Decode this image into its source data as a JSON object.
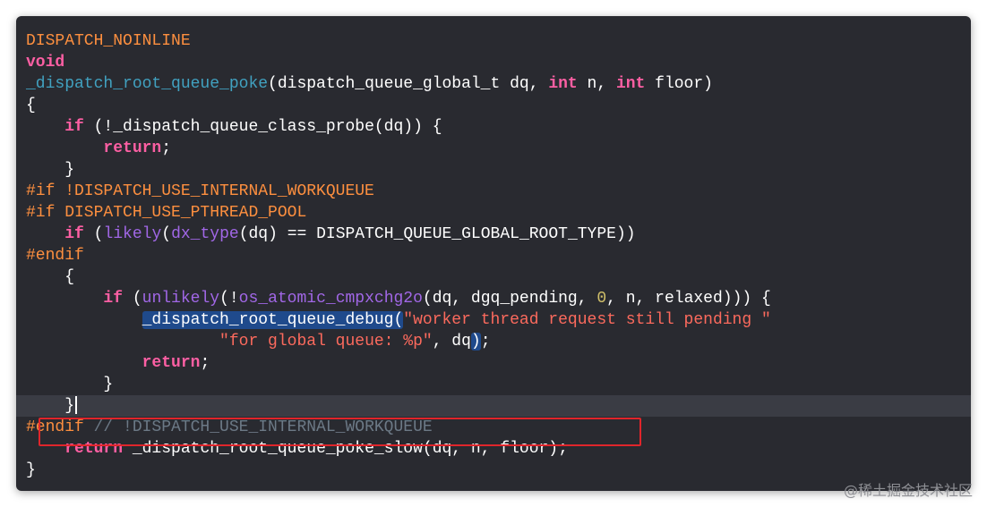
{
  "editor": {
    "background": "#292a30",
    "lines": [
      [
        {
          "t": "DISPATCH_NOINLINE",
          "c": "macro"
        }
      ],
      [
        {
          "t": "void",
          "c": "kw"
        }
      ],
      [
        {
          "t": "_dispatch_root_queue_poke",
          "c": "fn-def"
        },
        {
          "t": "(dispatch_queue_global_t dq, ",
          "c": "plain"
        },
        {
          "t": "int",
          "c": "kw"
        },
        {
          "t": " n, ",
          "c": "plain"
        },
        {
          "t": "int",
          "c": "kw"
        },
        {
          "t": " floor)",
          "c": "plain"
        }
      ],
      [
        {
          "t": "{",
          "c": "plain"
        }
      ],
      [
        {
          "t": "    ",
          "c": "plain"
        },
        {
          "t": "if",
          "c": "kw"
        },
        {
          "t": " (!_dispatch_queue_class_probe(dq)) {",
          "c": "plain"
        }
      ],
      [
        {
          "t": "        ",
          "c": "plain"
        },
        {
          "t": "return",
          "c": "kw"
        },
        {
          "t": ";",
          "c": "plain"
        }
      ],
      [
        {
          "t": "    }",
          "c": "plain"
        }
      ],
      [
        {
          "t": "#if !DISPATCH_USE_INTERNAL_WORKQUEUE",
          "c": "macro"
        }
      ],
      [
        {
          "t": "#if DISPATCH_USE_PTHREAD_POOL",
          "c": "macro"
        }
      ],
      [
        {
          "t": "    ",
          "c": "plain"
        },
        {
          "t": "if",
          "c": "kw"
        },
        {
          "t": " (",
          "c": "plain"
        },
        {
          "t": "likely",
          "c": "fn"
        },
        {
          "t": "(",
          "c": "plain"
        },
        {
          "t": "dx_type",
          "c": "fn"
        },
        {
          "t": "(dq) == DISPATCH_QUEUE_GLOBAL_ROOT_TYPE))",
          "c": "plain"
        }
      ],
      [
        {
          "t": "#endif",
          "c": "macro"
        }
      ],
      [
        {
          "t": "    {",
          "c": "plain"
        }
      ],
      [
        {
          "t": "        ",
          "c": "plain"
        },
        {
          "t": "if",
          "c": "kw"
        },
        {
          "t": " (",
          "c": "plain"
        },
        {
          "t": "unlikely",
          "c": "fn"
        },
        {
          "t": "(!",
          "c": "plain"
        },
        {
          "t": "os_atomic_cmpxchg2o",
          "c": "fn"
        },
        {
          "t": "(dq, dgq_pending, ",
          "c": "plain"
        },
        {
          "t": "0",
          "c": "num"
        },
        {
          "t": ", n, relaxed))) {",
          "c": "plain"
        }
      ],
      [
        {
          "t": "            ",
          "c": "plain"
        },
        {
          "t": "_dispatch_root_queue_debug(",
          "c": "plain",
          "hl": true
        },
        {
          "t": "\"worker thread request still pending \"",
          "c": "str"
        }
      ],
      [
        {
          "t": "                    ",
          "c": "plain"
        },
        {
          "t": "\"for global queue: %p\"",
          "c": "str"
        },
        {
          "t": ", dq",
          "c": "plain"
        },
        {
          "t": ")",
          "c": "plain",
          "hl": true
        },
        {
          "t": ";",
          "c": "plain"
        }
      ],
      [
        {
          "t": "            ",
          "c": "plain"
        },
        {
          "t": "return",
          "c": "kw"
        },
        {
          "t": ";",
          "c": "plain"
        }
      ],
      [
        {
          "t": "        }",
          "c": "plain"
        }
      ],
      [
        {
          "t": "    }",
          "c": "plain",
          "caret": true
        }
      ],
      [
        {
          "t": "#endif",
          "c": "macro"
        },
        {
          "t": " // !DISPATCH_USE_INTERNAL_WORKQUEUE",
          "c": "cmt"
        }
      ],
      [
        {
          "t": "    ",
          "c": "plain"
        },
        {
          "t": "return",
          "c": "kw"
        },
        {
          "t": " _dispatch_root_queue_poke_slow(dq, n, floor);",
          "c": "plain"
        }
      ],
      [
        {
          "t": "}",
          "c": "plain"
        }
      ]
    ],
    "current_line_index": 17,
    "highlighted_box_line_index": 19
  },
  "watermark": "@稀土掘金技术社区",
  "colors": {
    "keyword": "#fc5fa3",
    "macro": "#fd8f3f",
    "function_def": "#41a1c0",
    "function": "#a167e6",
    "string": "#fc6a5d",
    "number": "#d0bf69",
    "comment": "#6c7986",
    "selection": "#1f4a8c",
    "annotation_box": "#e0252b"
  }
}
